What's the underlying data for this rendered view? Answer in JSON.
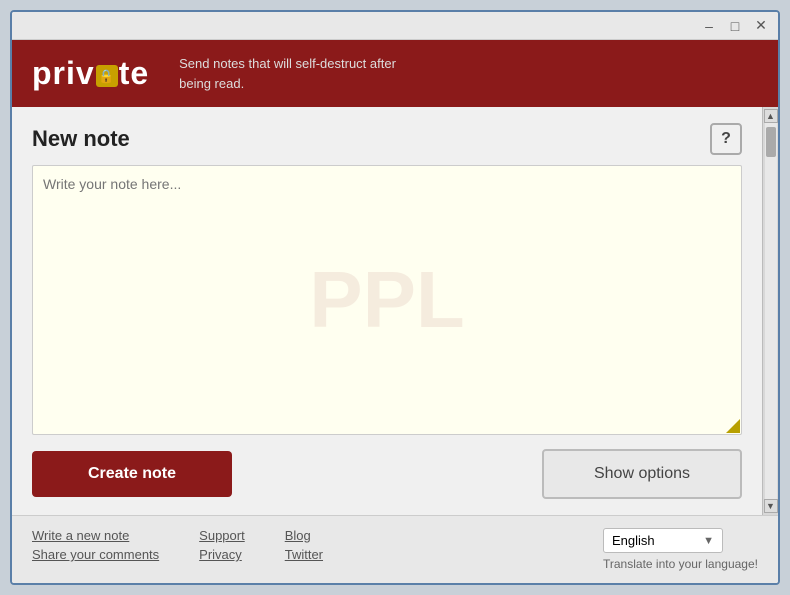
{
  "window": {
    "titlebar": {
      "minimize_label": "–",
      "maximize_label": "□",
      "close_label": "✕"
    }
  },
  "header": {
    "logo_text_before": "priv",
    "logo_text_after": "te",
    "tagline_line1": "Send notes that will self-destruct after",
    "tagline_line2": "being read."
  },
  "main": {
    "title": "New note",
    "help_label": "?",
    "note_placeholder": "Write your note here...",
    "create_button_label": "Create note",
    "show_options_label": "Show options"
  },
  "footer": {
    "links": {
      "write_new_note": "Write a new note",
      "share_comments": "Share your comments",
      "support": "Support",
      "privacy": "Privacy",
      "blog": "Blog",
      "twitter": "Twitter"
    },
    "language": {
      "selected": "English",
      "dropdown_arrow": "▼",
      "translate_text": "Translate into your language!"
    }
  }
}
